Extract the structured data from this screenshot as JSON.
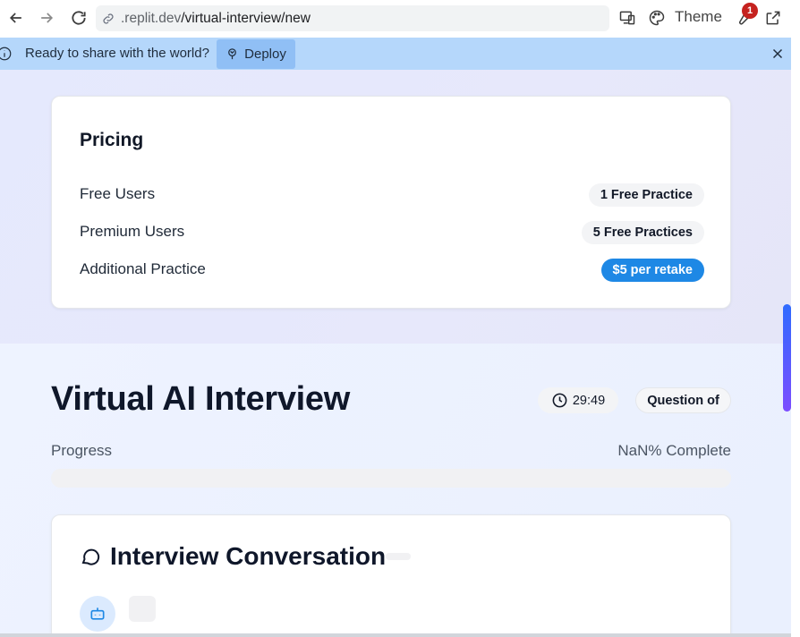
{
  "browser": {
    "url_host": ".replit.dev",
    "url_path": "/virtual-interview/new",
    "theme_label": "Theme",
    "notification_count": "1"
  },
  "banner": {
    "text": "Ready to share with the world?",
    "deploy_label": "Deploy",
    "background": "#b5d7fb"
  },
  "pricing": {
    "title": "Pricing",
    "rows": [
      {
        "label": "Free Users",
        "value": "1 Free Practice"
      },
      {
        "label": "Premium Users",
        "value": "5 Free Practices"
      },
      {
        "label": "Additional Practice",
        "value": "$5 per retake"
      }
    ]
  },
  "interview": {
    "title": "Virtual AI Interview",
    "timer": "29:49",
    "question_label": "Question of",
    "progress_label": "Progress",
    "progress_text": "NaN% Complete",
    "progress_fraction": 0
  },
  "conversation": {
    "title": "Interview Conversation"
  },
  "colors": {
    "accent": "#1e88e5",
    "heading": "#0f172a"
  },
  "icons": [
    "back-arrow-icon",
    "forward-arrow-icon",
    "reload-icon",
    "link-icon",
    "devices-icon",
    "palette-icon",
    "wrench-icon",
    "external-link-icon",
    "info-icon",
    "deploy-icon",
    "close-icon",
    "clock-icon",
    "chat-bubble-icon",
    "bot-icon"
  ]
}
